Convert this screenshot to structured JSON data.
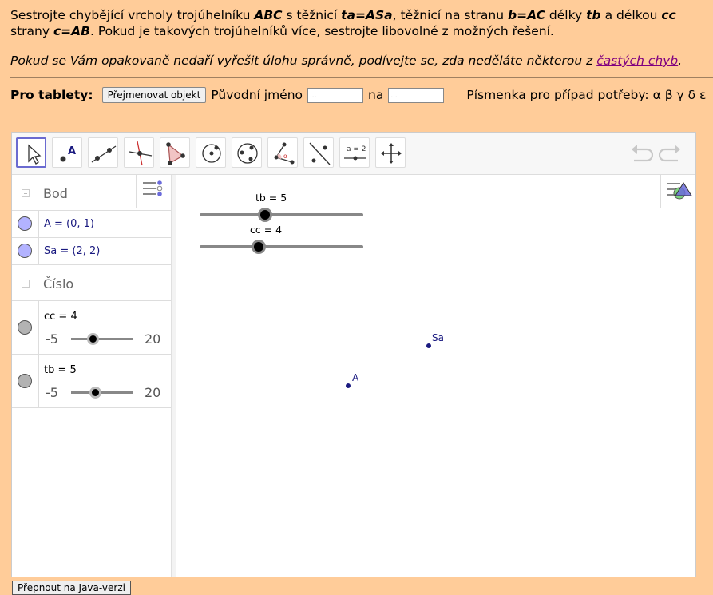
{
  "task": {
    "l1_a": "Sestrojte chybějící vrcholy trojúhelníku ",
    "l1_abc": "ABC",
    "l1_b": " s těžnicí ",
    "l1_ta": "ta",
    "l1_eq1": "=",
    "l1_asa": "ASa",
    "l1_c": ", těžnicí na stranu ",
    "l1_b_side": "b",
    "l1_eq2": "=",
    "l1_ac": "AC",
    "l1_d": " délky ",
    "l1_tb": "tb",
    "l1_e": " a délkou ",
    "l1_cc": "cc",
    "l2_a": "strany ",
    "l2_c": "c",
    "l2_eq": "=",
    "l2_ab": "AB",
    "l2_b": ". Pokud je takových trojúhelníků více, sestrojte libovolné z možných řešení."
  },
  "note": {
    "text": "Pokud se Vám opakovaně nedaří vyřešit úlohu správně, podívejte se, zda neděláte některou z ",
    "link": "častých chyb",
    "end": "."
  },
  "tablet": {
    "label": "Pro tablety:",
    "rename_button": "Přejmenovat objekt",
    "orig_label": "Původní jméno",
    "orig_placeholder": "...",
    "to_label": "na",
    "to_placeholder": "...",
    "letters": "Písmenka pro případ potřeby: α β γ δ ε"
  },
  "algebra": {
    "group_points": "Bod",
    "point_a": "A = (0, 1)",
    "point_sa": "Sa = (2, 2)",
    "group_numbers": "Číslo",
    "cc_label": "cc = 4",
    "cc_min": "-5",
    "cc_max": "20",
    "cc_value": 4,
    "tb_label": "tb = 5",
    "tb_min": "-5",
    "tb_max": "20",
    "tb_value": 5
  },
  "graphics": {
    "slider_tb_label": "tb = 5",
    "slider_tb_value": 5,
    "slider_cc_label": "cc = 4",
    "slider_cc_value": 4,
    "point_a_label": "A",
    "point_sa_label": "Sa"
  },
  "toolbar": {
    "tools": [
      "move-tool",
      "point-tool",
      "line-tool",
      "perpendicular-tool",
      "polygon-tool",
      "circle-center-tool",
      "circle-three-points-tool",
      "angle-tool",
      "reflect-tool",
      "slider-tool",
      "move-graphics-tool"
    ],
    "slider_tool_text": "a = 2"
  },
  "footer": {
    "java_button": "Přepnout na Java-verzi"
  },
  "colors": {
    "background": "#ffcc99",
    "point": "#1a1a80",
    "marble_points": "#b3b3ff",
    "marble_numbers": "#b3b3b3"
  }
}
